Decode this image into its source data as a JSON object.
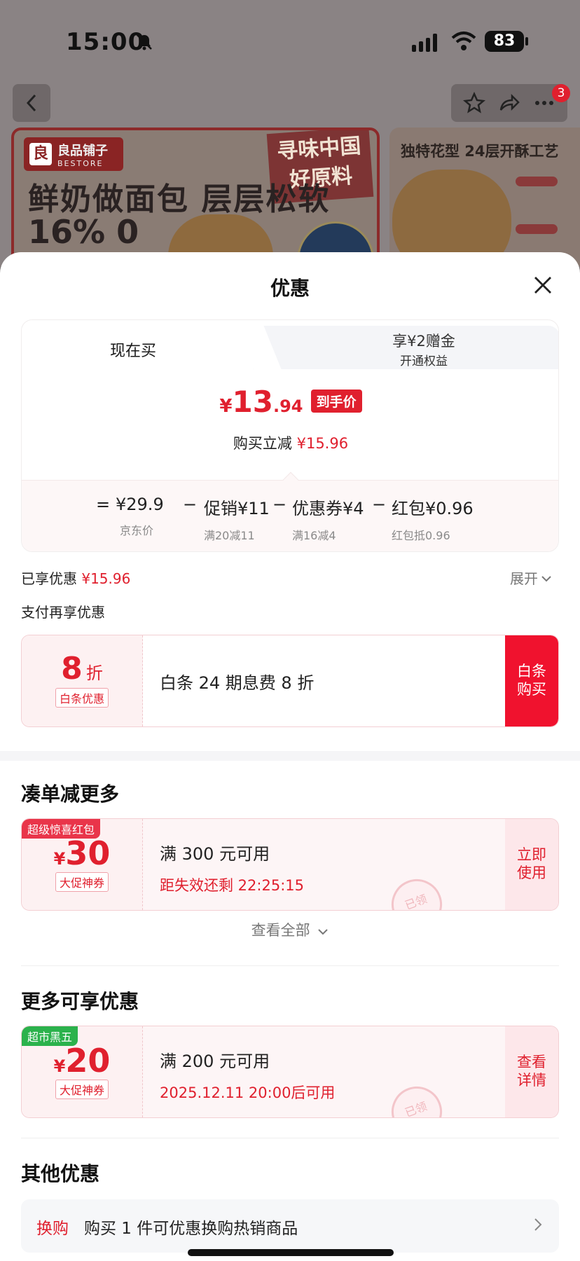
{
  "status_bar": {
    "time": "15:00",
    "battery": "83"
  },
  "nav": {
    "badge_count": "3"
  },
  "banner": {
    "brand_cn": "良品铺子",
    "brand_en": "BESTORE",
    "headline": "鲜奶做面包 层层松软",
    "numbers": "16% 0",
    "stamp_text": "寻味中国好原料",
    "side_title": "独特花型 24层开酥工艺"
  },
  "sheet": {
    "title": "优惠",
    "tabs": {
      "now": "现在买",
      "gift_line1": "享¥2赠金",
      "gift_line2": "开通权益"
    },
    "final_price": {
      "yen": "¥",
      "int": "13",
      "dec": ".94",
      "tag": "到手价"
    },
    "instant_cut": {
      "label": "购买立减",
      "value": "¥15.96"
    },
    "breakdown": {
      "equals": "=",
      "items": [
        {
          "main": "¥29.9",
          "sub": "京东价"
        },
        {
          "main": "促销¥11",
          "sub": "满20减11"
        },
        {
          "main": "优惠券¥4",
          "sub": "满16减4"
        },
        {
          "main": "红包¥0.96",
          "sub": "红包抵0.96"
        }
      ],
      "minus": "−"
    },
    "enjoyed": {
      "label": "已享优惠",
      "value": "¥15.96",
      "expand": "展开"
    },
    "pay_more": "支付再享优惠",
    "baitiao": {
      "discount_num": "8",
      "discount_unit": "折",
      "tag": "白条优惠",
      "desc": "白条 24 期息费 8 折",
      "action": "白条购买"
    },
    "section_more": {
      "title": "凑单减更多",
      "coupon": {
        "corner": "超级惊喜红包",
        "yen": "¥",
        "amount": "30",
        "tag": "大促神券",
        "condition": "满 300 元可用",
        "expire": "距失效还剩 22:25:15",
        "action": "立即使用",
        "stamp": "已领"
      },
      "see_all": "查看全部"
    },
    "section_extra": {
      "title": "更多可享优惠",
      "coupon": {
        "corner": "超市黑五",
        "yen": "¥",
        "amount": "20",
        "tag": "大促神券",
        "condition": "满 200 元可用",
        "valid_from": "2025.12.11 20:00后可用",
        "action": "查看详情",
        "stamp": "已领"
      }
    },
    "section_other": {
      "title": "其他优惠",
      "row_label": "换购",
      "row_text": "购买 1 件可优惠换购热销商品"
    }
  },
  "colors": {
    "accent": "#e0202e",
    "green_tag": "#2bb24c"
  }
}
